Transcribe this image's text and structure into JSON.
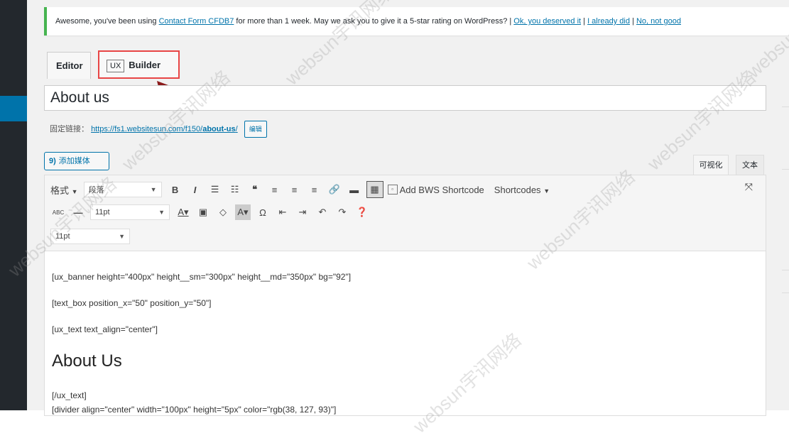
{
  "notice": {
    "text_before": "Awesome, you've been using ",
    "link_plugin": "Contact Form CFDB7",
    "text_after": " for more than 1 week. May we ask you to give it a 5-star rating on WordPress? | ",
    "link_ok": "Ok, you deserved it",
    "sep1": " | ",
    "link_already": "I already did",
    "sep2": " | ",
    "link_no": "No, not good"
  },
  "tabs": {
    "editor": "Editor",
    "ux_badge": "UX",
    "builder": "Builder"
  },
  "post": {
    "title": "About us"
  },
  "permalink": {
    "label": "固定链接：",
    "url": "https://fs1.websitesun.com/f150/",
    "slug": "about-us",
    "trail": "/",
    "edit_button": "编辑"
  },
  "media": {
    "button_label": "添加媒体"
  },
  "mode_tabs": {
    "visual": "可视化",
    "text": "文本"
  },
  "toolbar": {
    "format_label": "格式",
    "paragraph_select": "段落",
    "bold": "B",
    "italic": "I",
    "bws_label": "Add BWS Shortcode",
    "shortcodes_label": "Shortcodes",
    "font_size_1": "11pt",
    "font_size_2": "11pt"
  },
  "content": {
    "line1": "[ux_banner height=\"400px\" height__sm=\"300px\" height__md=\"350px\" bg=\"92\"]",
    "line2": "[text_box position_x=\"50\" position_y=\"50\"]",
    "line3": "[ux_text text_align=\"center\"]",
    "heading": "About Us",
    "line4": "[/ux_text]",
    "line5": "[divider align=\"center\" width=\"100px\" height=\"5px\" color=\"rgb(38, 127, 93)\"]"
  },
  "watermark": {
    "text": "websun宇讯网络"
  },
  "colors": {
    "link": "#0073aa",
    "highlight_border": "#e84545",
    "notice_accent": "#46b450",
    "admin_bar": "#23282d"
  }
}
